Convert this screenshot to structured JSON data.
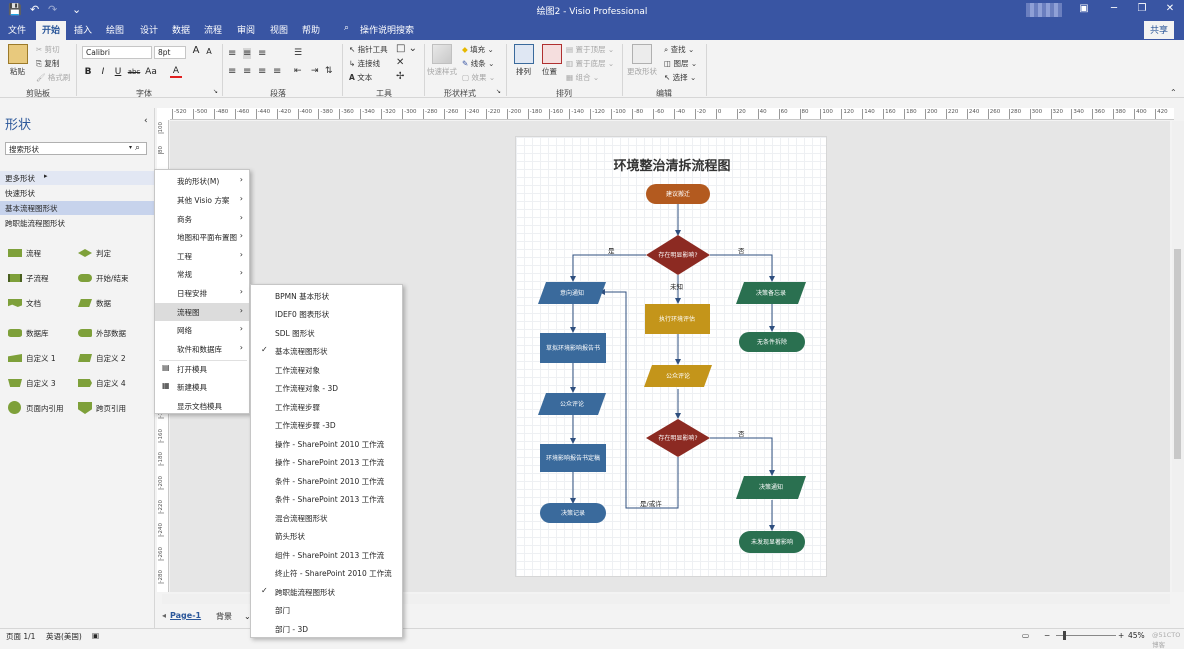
{
  "titlebar": {
    "title": "绘图2  -  Visio Professional",
    "save_icon": "💾",
    "undo": "↶",
    "redo": "↷",
    "more": "⌄"
  },
  "tabs": [
    "文件",
    "开始",
    "插入",
    "绘图",
    "设计",
    "数据",
    "流程",
    "审阅",
    "视图",
    "帮助"
  ],
  "tell_me": "操作说明搜索",
  "share": "共享",
  "ribbon": {
    "clipboard": {
      "paste": "粘贴",
      "cut": "剪切",
      "copy": "复制",
      "format_painter": "格式刷",
      "label": "剪贴板"
    },
    "font": {
      "name": "Calibri",
      "size": "8pt",
      "grow": "A",
      "shrink": "A",
      "bold": "B",
      "italic": "I",
      "underline": "U",
      "strike": "abc",
      "case": "Aa",
      "color": "A",
      "label": "字体"
    },
    "paragraph": {
      "label": "段落"
    },
    "tools": {
      "pointer": "指针工具",
      "connector": "连接线",
      "text": "文本",
      "label": "工具"
    },
    "shape_styles": {
      "quick": "快速样式",
      "fill": "填充",
      "line": "线条",
      "effects": "效果",
      "label": "形状样式"
    },
    "arrange": {
      "arrange": "排列",
      "position": "位置",
      "bring_front": "置于顶层",
      "send_back": "置于底层",
      "group": "组合",
      "label": "排列"
    },
    "editing": {
      "change_shape": "更改形状",
      "find": "查找",
      "layers": "图层",
      "select": "选择",
      "label": "编辑"
    }
  },
  "panel": {
    "title": "形状",
    "search_placeholder": "搜索形状",
    "links": [
      "更多形状",
      "快速形状",
      "基本流程图形状",
      "跨职能流程图形状"
    ],
    "stencils": [
      {
        "label": "流程",
        "icon": "process-icon"
      },
      {
        "label": "判定",
        "icon": "decision-icon"
      },
      {
        "label": "子流程",
        "icon": "subprocess-icon"
      },
      {
        "label": "开始/结束",
        "icon": "terminator-icon"
      },
      {
        "label": "文档",
        "icon": "document-icon"
      },
      {
        "label": "数据",
        "icon": "data-icon"
      },
      {
        "label": "数据库",
        "icon": "database-icon"
      },
      {
        "label": "外部数据",
        "icon": "external-data-icon"
      },
      {
        "label": "自定义 1",
        "icon": "custom1-icon"
      },
      {
        "label": "自定义 2",
        "icon": "custom2-icon"
      },
      {
        "label": "自定义 3",
        "icon": "custom3-icon"
      },
      {
        "label": "自定义 4",
        "icon": "custom4-icon"
      },
      {
        "label": "页面内引用",
        "icon": "on-page-ref-icon"
      },
      {
        "label": "跨页引用",
        "icon": "off-page-ref-icon"
      }
    ]
  },
  "menu1": [
    "我的形状(M)",
    "其他 Visio 方案",
    "商务",
    "地图和平面布置图",
    "工程",
    "常规",
    "日程安排",
    "流程图",
    "网络",
    "软件和数据库",
    "打开模具",
    "新建模具",
    "显示文档模具"
  ],
  "menu2": [
    "BPMN 基本形状",
    "IDEF0 图表形状",
    "SDL 图形状",
    "基本流程图形状",
    "工作流程对象",
    "工作流程对象 - 3D",
    "工作流程步骤",
    "工作流程步骤 -3D",
    "操作 - SharePoint 2010 工作流",
    "操作 - SharePoint 2013 工作流",
    "条件 - SharePoint 2010 工作流",
    "条件 - SharePoint 2013 工作流",
    "混合流程图形状",
    "箭头形状",
    "组件 - SharePoint 2013 工作流",
    "终止符 - SharePoint 2010 工作流",
    "跨职能流程图形状",
    "部门",
    "部门 - 3D"
  ],
  "ruler_top": [
    "-520",
    "-500",
    "-480",
    "-460",
    "-440",
    "-420",
    "-400",
    "-380",
    "-360",
    "-340",
    "-320",
    "-300",
    "-280",
    "-260",
    "-240",
    "-220",
    "-200",
    "-180",
    "-160",
    "-140",
    "-120",
    "-100",
    "-80",
    "-60",
    "-40",
    "-20",
    "0",
    "20",
    "40",
    "60",
    "80",
    "100",
    "120",
    "140",
    "160",
    "180",
    "200",
    "220",
    "240",
    "260",
    "280",
    "300",
    "320",
    "340",
    "360",
    "380",
    "400",
    "420"
  ],
  "ruler_left": [
    "100",
    "80",
    "60",
    "40",
    "20",
    "0",
    "-20",
    "-40",
    "-60",
    "-80",
    "-100",
    "-120",
    "-140",
    "-160",
    "-180",
    "-200",
    "-220",
    "-240",
    "-260",
    "-280"
  ],
  "diagram": {
    "title": "环境整治清拆流程图",
    "nodes": {
      "start": "建议搬迁",
      "d1": "存在明显影响?",
      "notify": "意向通知",
      "record": "决策备忘录",
      "eval": "执行环境评估",
      "report": "草拟环境影响报告书",
      "nocond": "无条件拆除",
      "public1": "公众评论",
      "public2": "公众评论",
      "d2": "存在明显影响?",
      "final": "环境影响报告书定稿",
      "notice": "决策通知",
      "decision": "决策记录",
      "noimpact": "未发现显著影响"
    },
    "edge_labels": {
      "yes": "是",
      "no": "否",
      "unknown": "未知",
      "no2": "否",
      "yes_maybe": "是/或许"
    }
  },
  "colors": {
    "brand": "#3955a3",
    "orange": "#b35a1f",
    "red": "#8c2a22",
    "blue": "#3a6a9c",
    "green": "#2a7050",
    "gold": "#c4951a"
  },
  "page_tabs": {
    "page1": "Page-1",
    "bg": "背景",
    "all": "全部"
  },
  "status": {
    "page": "页面 1/1",
    "lang": "英语(美国)",
    "zoom": "45%",
    "watermark": "@51CTO博客"
  }
}
